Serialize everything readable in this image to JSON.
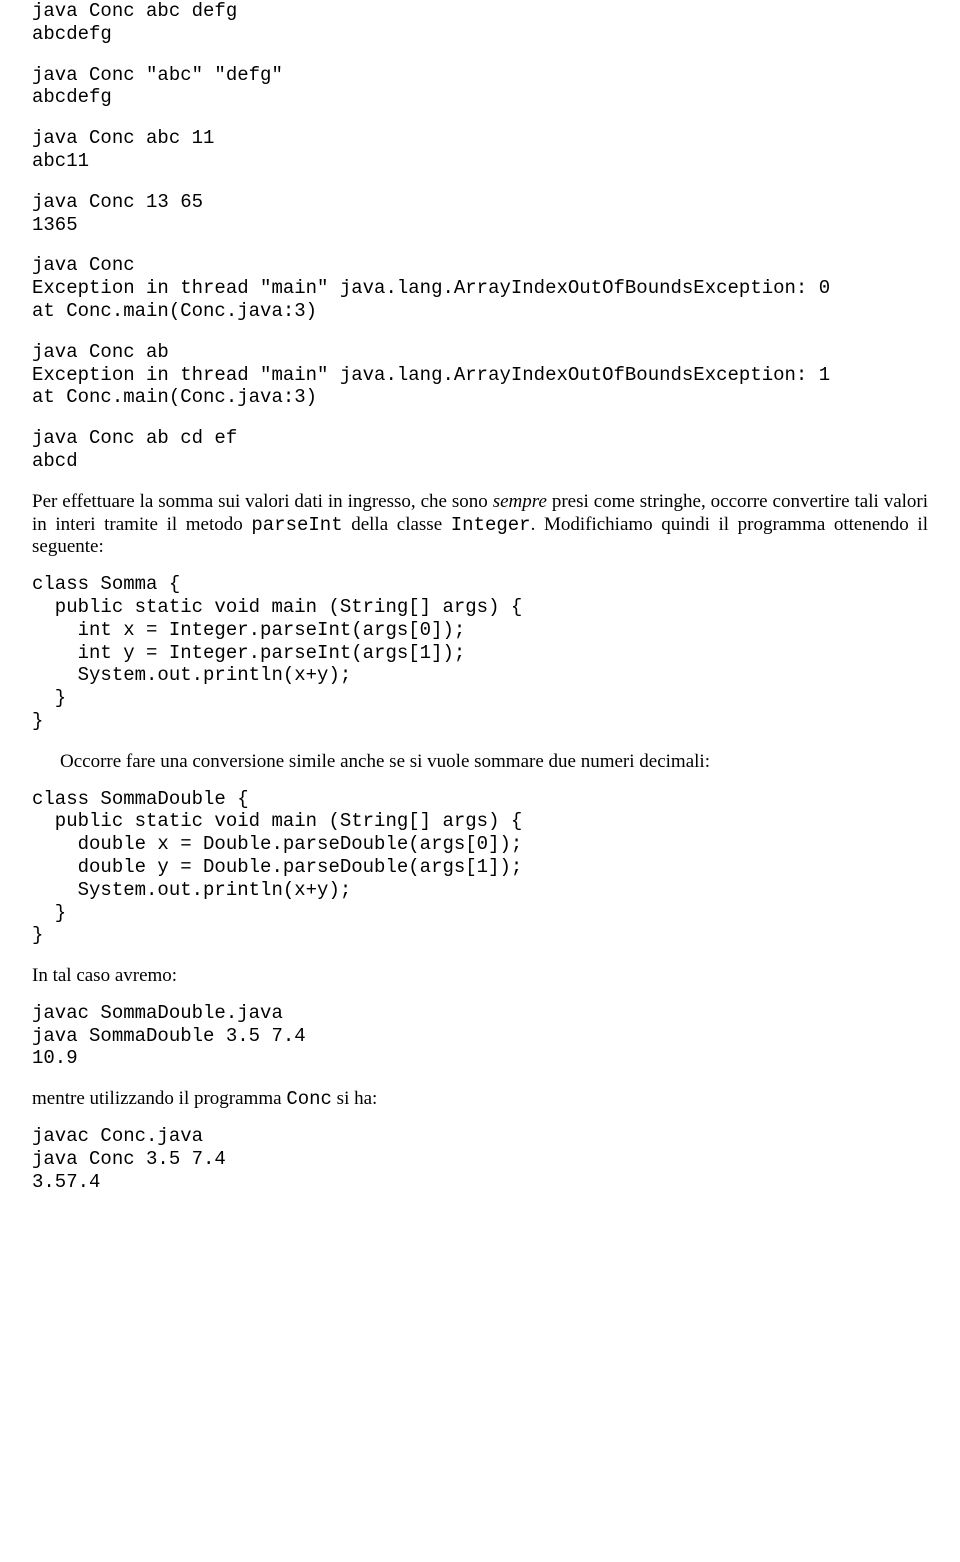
{
  "block1": "java Conc abc defg\nabcdefg",
  "block2": "java Conc \"abc\" \"defg\"\nabcdefg",
  "block3": "java Conc abc 11\nabc11",
  "block4": "java Conc 13 65\n1365",
  "block5": "java Conc\nException in thread \"main\" java.lang.ArrayIndexOutOfBoundsException: 0\nat Conc.main(Conc.java:3)",
  "block6": "java Conc ab\nException in thread \"main\" java.lang.ArrayIndexOutOfBoundsException: 1\nat Conc.main(Conc.java:3)",
  "block7": "java Conc ab cd ef\nabcd",
  "para1_a": "Per effettuare la somma sui valori dati in ingresso, che sono ",
  "para1_em": "sempre",
  "para1_b": " presi come stringhe, occorre convertire tali valori in interi tramite il metodo ",
  "para1_code1": "parseInt",
  "para1_c": " della classe ",
  "para1_code2": "Integer",
  "para1_d": ". Modifichiamo quindi il programma ottenendo il seguente:",
  "code_somma": "class Somma {\n  public static void main (String[] args) {\n    int x = Integer.parseInt(args[0]);\n    int y = Integer.parseInt(args[1]);\n    System.out.println(x+y);\n  }\n}",
  "para2": "Occorre fare una conversione simile anche se si vuole sommare due numeri decimali:",
  "code_sommadouble": "class SommaDouble {\n  public static void main (String[] args) {\n    double x = Double.parseDouble(args[0]);\n    double y = Double.parseDouble(args[1]);\n    System.out.println(x+y);\n  }\n}",
  "para3": "In tal caso avremo:",
  "block8": "javac SommaDouble.java\njava SommaDouble 3.5 7.4\n10.9",
  "para4_a": "mentre utilizzando il programma ",
  "para4_code": "Conc",
  "para4_b": " si ha:",
  "block9": "javac Conc.java\njava Conc 3.5 7.4\n3.57.4"
}
